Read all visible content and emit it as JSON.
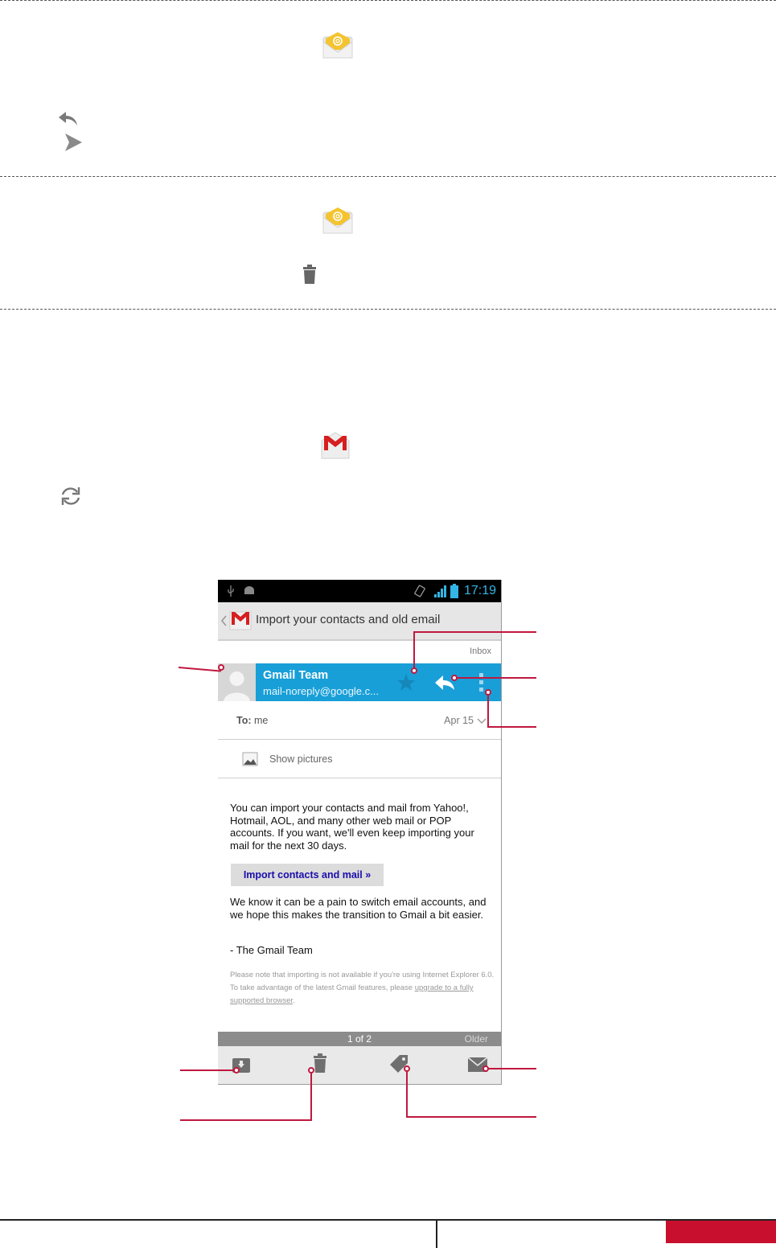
{
  "email_screen": {
    "status_time": "17:19",
    "subject": "Import your contacts and old email",
    "folder_label": "Inbox",
    "sender_name": "Gmail Team",
    "sender_address": "mail-noreply@google.c...",
    "to_label": "To:",
    "to_value": "me",
    "date": "Apr 15",
    "show_pictures": "Show pictures",
    "body_paragraph_1": "You can import your contacts and mail from Yahoo!, Hotmail, AOL, and many other web mail or POP accounts. If you want, we'll even keep importing your mail for the next 30 days.",
    "import_button": "Import contacts and mail »",
    "body_paragraph_2": "We know it can be a pain to switch email accounts, and we hope this makes the transition to Gmail a bit easier.",
    "signature": "- The Gmail Team",
    "note_text": "Please note that importing is not available if you're using Internet Explorer 6.0. To take advantage of the latest Gmail features, please",
    "note_link": "upgrade to a fully supported browser",
    "note_end": ".",
    "pager_count": "1 of 2",
    "pager_older": "Older"
  },
  "colors": {
    "accent_blue": "#189fd8",
    "status_blue": "#33b5e5",
    "callout_red": "#c0183f",
    "footer_red": "#c8102e"
  }
}
